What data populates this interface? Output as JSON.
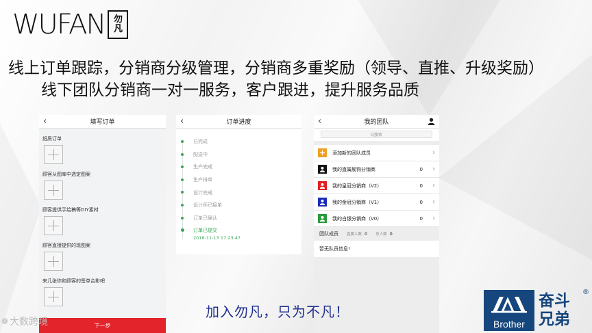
{
  "logo": {
    "text": "WUFAN",
    "box_top": "勿",
    "box_bottom": "凡"
  },
  "headline": {
    "line1": "线上订单跟踪，分销商分级管理，分销商多重奖励（领导、直推、升级奖励）",
    "line2": "线下团队分销商一对一服务，客户跟进，提升服务品质"
  },
  "screen1": {
    "title": "填写订单",
    "sections": [
      "纸质订单",
      "顾客从图库中选定图案",
      "顾客提供手绘稿等DIY素材",
      "顾客直接提供的现图案",
      "来几张你和顾客的签单合影吧"
    ],
    "next_label": "下一步"
  },
  "screen2": {
    "title": "订单进度",
    "steps": [
      "已完成",
      "配送中",
      "生产完成",
      "生产排单",
      "设计完成",
      "设计师已接单",
      "订单已确认"
    ],
    "current": {
      "label": "订单已提交",
      "time": "2016-11-13 17:23:47"
    }
  },
  "screen3": {
    "title": "我的团队",
    "search_placeholder": "Q搜索",
    "rows": [
      {
        "label": "添加新的团队成员",
        "count": "",
        "color": "#f0a020"
      },
      {
        "label": "我的直属舰钩分销商",
        "count": "0",
        "color": "#111111"
      },
      {
        "label": "我的皇冠分销商（V2）",
        "count": "0",
        "color": "#e02020"
      },
      {
        "label": "我的金冠分销商（V1）",
        "count": "0",
        "color": "#1a2bb8"
      },
      {
        "label": "我的白银分销商（V0）",
        "count": "0",
        "color": "#2a9a3a"
      }
    ],
    "stats": {
      "title": "团队成员",
      "direct_label": "直属人数",
      "direct_value": "0",
      "total_label": "总人数",
      "total_value": "0"
    },
    "empty_text": "暂无队员信息!"
  },
  "slogan": "加入勿凡，只为不凡！",
  "watermark": "大数跨境",
  "brand": {
    "en": "Brother",
    "cn_line1": "奋斗",
    "cn_line2": "兄弟",
    "reg": "®",
    "color": "#16467e"
  }
}
